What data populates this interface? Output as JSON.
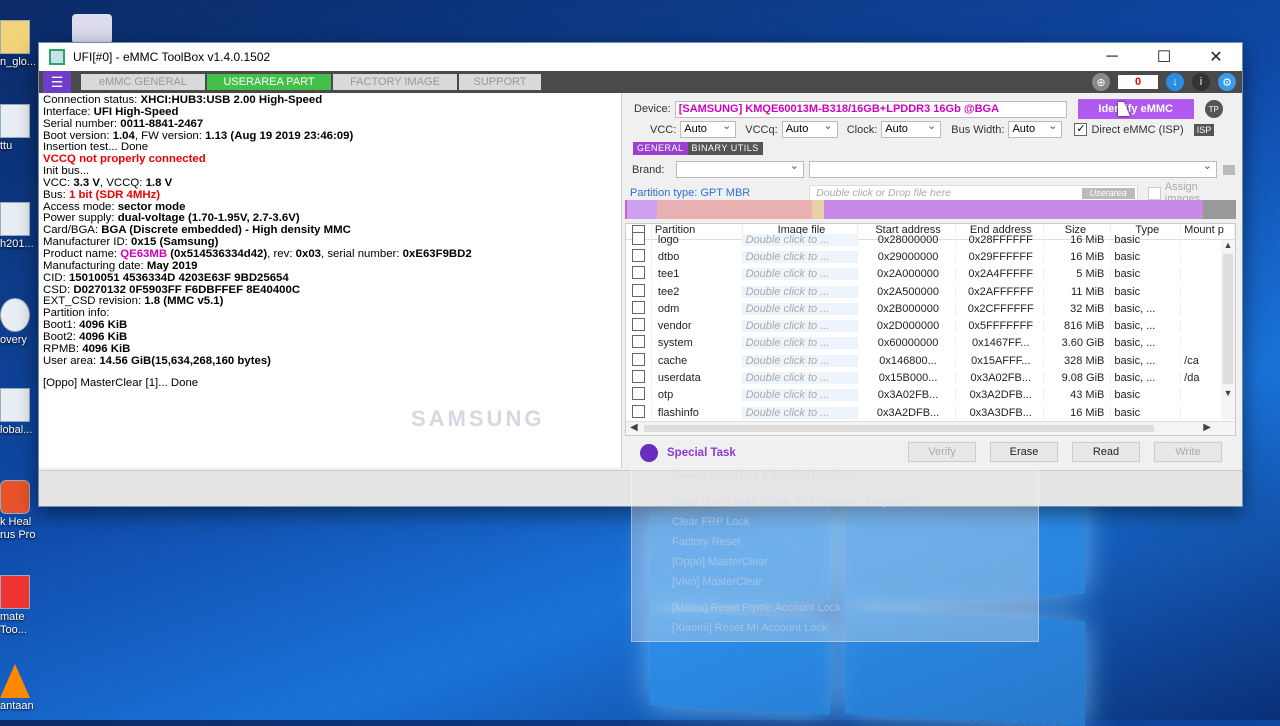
{
  "desktop": {
    "icons": [
      {
        "label": "n_glo..."
      },
      {
        "label": "ttu"
      },
      {
        "label": "h201..."
      },
      {
        "label": "overy"
      },
      {
        "label": "lobal..."
      },
      {
        "label": "k Heal\nrus Pro"
      },
      {
        "label": "mate\nToo..."
      },
      {
        "label": "antaan"
      }
    ]
  },
  "window": {
    "title": "UFI[#0] - eMMC ToolBox v1.4.0.1502",
    "controls": {
      "minimize": "─",
      "maximize": "☐",
      "close": "✕"
    }
  },
  "menubar": {
    "tabs": [
      {
        "label": "eMMC GENERAL",
        "active": false
      },
      {
        "label": "USERAREA PART",
        "active": true
      },
      {
        "label": "FACTORY IMAGE",
        "active": false
      },
      {
        "label": "SUPPORT",
        "active": false
      }
    ],
    "counter": "0",
    "accent": "#44c04a"
  },
  "log": {
    "connection_label": "Connection status: ",
    "connection": "XHCI:HUB3:USB 2.00 High-Speed",
    "interface_label": "Interface: ",
    "interface": "UFI High-Speed",
    "serial_label": "Serial number: ",
    "serial": "0011-8841-2467",
    "boot_label": " Boot version: ",
    "boot": "1.04",
    "fw_label": ", FW version: ",
    "fw": "1.13 (Aug 19 2019 23:46:09)",
    "insertion": "Insertion test... Done",
    "vccq_error": "VCCQ not properly connected",
    "init": "Init bus...",
    "vcc_label": "VCC: ",
    "vcc": "3.3 V",
    "vccq_label": ", VCCQ: ",
    "vccq": "1.8 V",
    "bus_label": "Bus: ",
    "bus": "1 bit (SDR 4MHz)",
    "access_label": "Access mode: ",
    "access": "sector mode",
    "power_label": "Power supply: ",
    "power": "dual-voltage (1.70-1.95V, 2.7-3.6V)",
    "card_label": " Card/BGA: ",
    "card": "BGA (Discrete embedded) - High density MMC",
    "manuf_label": " Manufacturer ID: ",
    "manuf": "0x15 (Samsung)",
    "product_label": " Product name: ",
    "product": "QE63MB",
    "product_hex": " (0x514536334d42)",
    "rev_label": ", rev: ",
    "rev": "0x03",
    "sn_label": ", serial number: ",
    "sn": "0xE63F9BD2",
    "date_label": " Manufacturing date: ",
    "date": "May 2019",
    "cid_label": "CID: ",
    "cid": "15010051 4536334D 4203E63F 9BD25654",
    "csd_label": "CSD: ",
    "csd": "D0270132 0F5903FF F6DBFFEF 8E40400C",
    "ext_label": "EXT_CSD revision: ",
    "ext": "1.8 (MMC v5.1)",
    "partinfo": "Partition info:",
    "boot1_label": " Boot1: ",
    "boot1": "4096 KiB",
    "boot2_label": " Boot2: ",
    "boot2": "4096 KiB",
    "rpmb_label": " RPMB: ",
    "rpmb": "4096 KiB",
    "userarea_label": " User area: ",
    "userarea": "14.56 GiB(15,634,268,160 bytes)",
    "masterclear": "[Oppo] MasterClear [1]... Done",
    "watermark": "SAMSUNG"
  },
  "right": {
    "device_label": "Device:",
    "device_value": "[SAMSUNG] KMQE60013M-B318/16GB+LPDDR3 16Gb  @BGA",
    "identify_label": "Identify eMMC",
    "tp_label": "TP",
    "vcc_label": "VCC:",
    "vcc_value": "Auto",
    "vccq_label": "VCCq:",
    "vccq_value": "Auto",
    "clock_label": "Clock:",
    "clock_value": "Auto",
    "buswidth_label": "Bus Width:",
    "buswidth_value": "Auto",
    "direct_label": "Direct eMMC (ISP)",
    "isp_label": "ISP",
    "subtab_general": "GENERAL",
    "subtab_binary": "BINARY UTILS",
    "brand_label": "Brand:",
    "partition_type": "Partition type: GPT MBR",
    "drop_placeholder": "Double click or Drop file here",
    "userarea_badge": "Userarea",
    "assign_images": "Assign images",
    "colors": {
      "purple": "#b05af0",
      "magenta": "#d000c0"
    }
  },
  "table": {
    "headers": [
      "Partition",
      "Image file",
      "Start address",
      "End address",
      "Size",
      "Type",
      "Mount p"
    ],
    "rows": [
      {
        "name": "logo",
        "image": "Double click to ...",
        "start": "0x28000000",
        "end": "0x28FFFFFF",
        "size": "16 MiB",
        "type": "basic",
        "mount": ""
      },
      {
        "name": "dtbo",
        "image": "Double click to ...",
        "start": "0x29000000",
        "end": "0x29FFFFFF",
        "size": "16 MiB",
        "type": "basic",
        "mount": ""
      },
      {
        "name": "tee1",
        "image": "Double click to ...",
        "start": "0x2A000000",
        "end": "0x2A4FFFFF",
        "size": "5 MiB",
        "type": "basic",
        "mount": ""
      },
      {
        "name": "tee2",
        "image": "Double click to ...",
        "start": "0x2A500000",
        "end": "0x2AFFFFFF",
        "size": "11 MiB",
        "type": "basic",
        "mount": ""
      },
      {
        "name": "odm",
        "image": "Double click to ...",
        "start": "0x2B000000",
        "end": "0x2CFFFFFF",
        "size": "32 MiB",
        "type": "basic, ...",
        "mount": ""
      },
      {
        "name": "vendor",
        "image": "Double click to ...",
        "start": "0x2D000000",
        "end": "0x5FFFFFFF",
        "size": "816 MiB",
        "type": "basic, ...",
        "mount": ""
      },
      {
        "name": "system",
        "image": "Double click to ...",
        "start": "0x60000000",
        "end": "0x1467FF...",
        "size": "3.60 GiB",
        "type": "basic, ...",
        "mount": ""
      },
      {
        "name": "cache",
        "image": "Double click to ...",
        "start": "0x146800...",
        "end": "0x15AFFF...",
        "size": "328 MiB",
        "type": "basic, ...",
        "mount": "/ca"
      },
      {
        "name": "userdata",
        "image": "Double click to ...",
        "start": "0x15B000...",
        "end": "0x3A02FB...",
        "size": "9.08 GiB",
        "type": "basic, ...",
        "mount": "/da"
      },
      {
        "name": "otp",
        "image": "Double click to ...",
        "start": "0x3A02FB...",
        "end": "0x3A2DFB...",
        "size": "43 MiB",
        "type": "basic",
        "mount": ""
      },
      {
        "name": "flashinfo",
        "image": "Double click to ...",
        "start": "0x3A2DFB...",
        "end": "0x3A3DFB...",
        "size": "16 MiB",
        "type": "basic",
        "mount": ""
      }
    ]
  },
  "actions": {
    "special_task": "Special Task",
    "verify": "Verify",
    "erase": "Erase",
    "read": "Read",
    "write": "Write"
  },
  "context_menu": {
    "items": [
      "Resize User Data & Realign Partitions",
      "Clear User Locks (Code, PIN, Gesture, Fingerprint)",
      "Clear FRP Lock",
      "Factory Reset",
      "[Oppo] MasterClear",
      "[Vivo] MasterClear",
      "[Meizu] Reset Flyme Account Lock",
      "[Xiaomi] Reset MI Account Lock"
    ]
  }
}
